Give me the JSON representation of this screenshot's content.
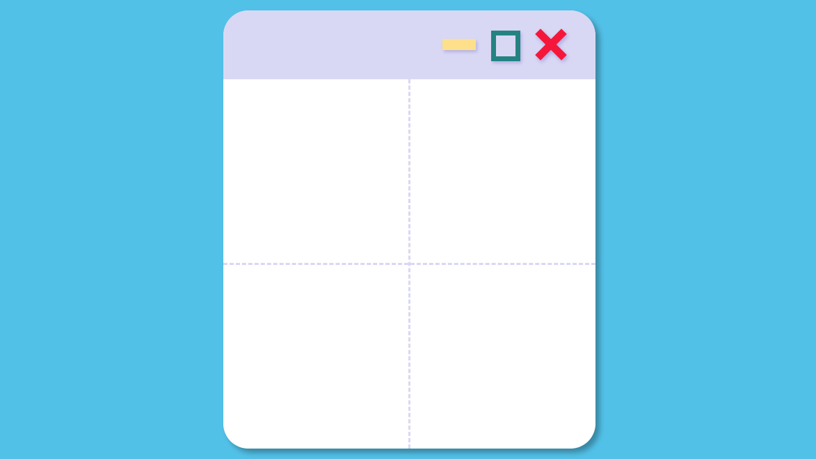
{
  "colors": {
    "desktop_background": "#52C1E8",
    "window_background": "#FFFFFF",
    "titlebar_background": "#D9D8F4",
    "divider": "#D9D8F4",
    "minimize": "#FFE08A",
    "maximize": "#248381",
    "close": "#F5173A"
  },
  "titlebar": {
    "controls": [
      {
        "name": "minimize",
        "icon": "minimize-icon"
      },
      {
        "name": "maximize",
        "icon": "maximize-icon"
      },
      {
        "name": "close",
        "icon": "close-icon"
      }
    ]
  },
  "content": {
    "layout": "2x2 grid",
    "panes": [
      "top-left",
      "top-right",
      "bottom-left",
      "bottom-right"
    ]
  }
}
